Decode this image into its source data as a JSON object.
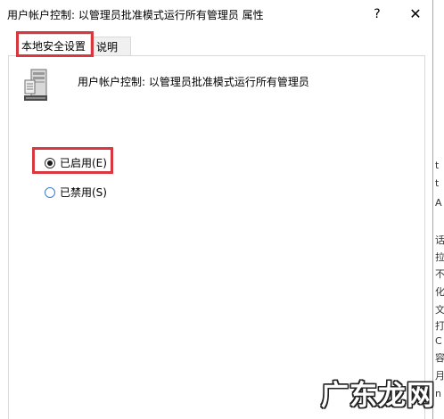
{
  "dialog": {
    "title": "用户帐户控制: 以管理员批准模式运行所有管理员 属性",
    "help_symbol": "?",
    "close_symbol": "✕",
    "tabs": [
      {
        "label": "本地安全设置",
        "active": true
      },
      {
        "label": "说明",
        "active": false
      }
    ],
    "policy_icon": "server-icon",
    "policy_title": "用户帐户控制: 以管理员批准模式运行所有管理员",
    "options": [
      {
        "label": "已启用(E)",
        "checked": true
      },
      {
        "label": "已禁用(S)",
        "checked": false
      }
    ]
  },
  "background_window": {
    "left_fragments": [
      "]",
      "[",
      "["
    ],
    "right_fragments": [
      "t",
      "t",
      "A",
      "话",
      "拉",
      "不",
      "化",
      "文",
      "打",
      "C",
      "容",
      "月",
      "n"
    ]
  },
  "watermark": {
    "text": "广东龙网"
  },
  "colors": {
    "highlight_box": "#d7373f",
    "radio_unselected_border": "#3c7fd1",
    "tab_border": "#d9d9d9"
  }
}
